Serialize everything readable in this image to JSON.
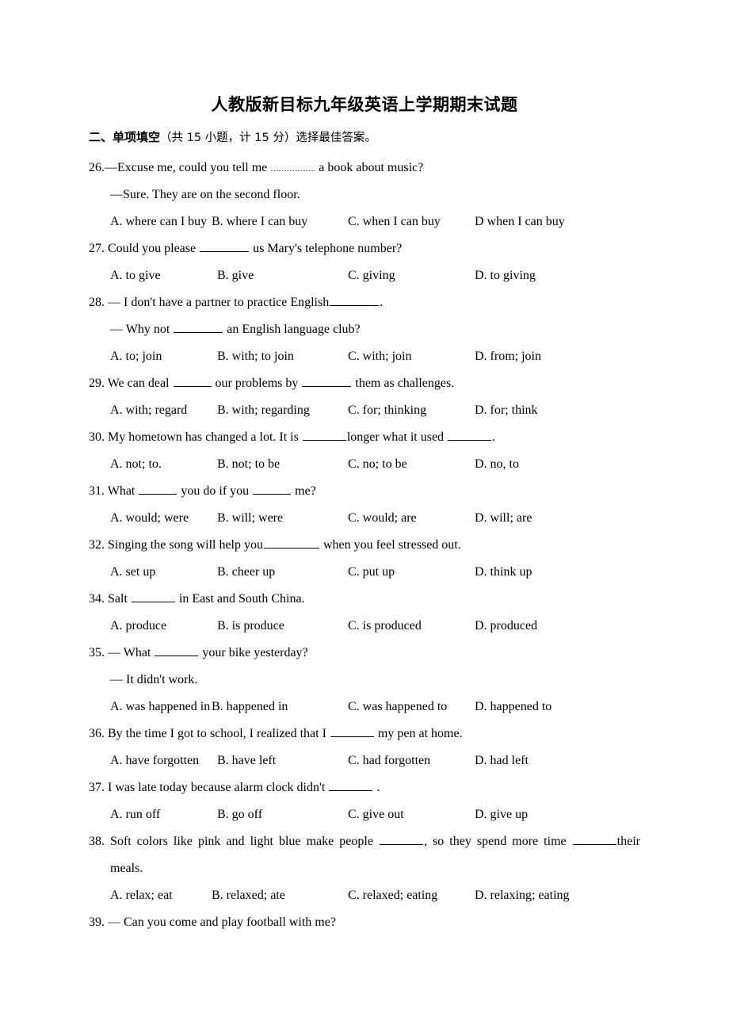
{
  "document": {
    "title": "人教版新目标九年级英语上学期期末试题",
    "section_heading": {
      "bold_part": "二、单项填空",
      "rest": "（共 15 小题，计 15 分）选择最佳答案。"
    }
  },
  "questions": [
    {
      "number": "26.",
      "stem_pre": "—Excuse me, could you tell me",
      "stem_post": "a book about music?",
      "reply": "—Sure. They are on the second floor.",
      "options": [
        "A. where can I buy",
        "B. where I can buy",
        "C. when I can buy",
        "D when I can buy"
      ]
    },
    {
      "number": "27.",
      "stem_pre": "Could you please",
      "stem_post": "us Mary's telephone number?",
      "options": [
        "A. to give",
        "B. give",
        "C. giving",
        "D. to giving"
      ]
    },
    {
      "number": "28.",
      "stem_pre": "— I don't have a partner to practice English",
      "stem_post": ".",
      "reply_pre": "— Why not",
      "reply_post": "an English language club?",
      "options": [
        "A. to; join",
        "B. with; to join",
        "C. with; join",
        "D. from; join"
      ]
    },
    {
      "number": "29.",
      "stem_pre": "We can deal",
      "stem_mid": "our problems by",
      "stem_post": "them as challenges.",
      "options": [
        "A. with; regard",
        "B. with; regarding",
        "C. for; thinking",
        "D. for; think"
      ]
    },
    {
      "number": "30.",
      "stem_pre": "My hometown has changed a lot. It is",
      "stem_mid": "longer what it used",
      "stem_post": ".",
      "options": [
        "A. not; to.",
        "B. not; to be",
        "C. no; to be",
        "D. no, to"
      ]
    },
    {
      "number": "31.",
      "stem_pre": "What",
      "stem_mid": "you do if you",
      "stem_post": "me?",
      "options": [
        "A. would; were",
        "B. will; were",
        "C. would; are",
        "D. will; are"
      ]
    },
    {
      "number": "32.",
      "stem_pre": "Singing the song will help you",
      "stem_post": "when you feel stressed out.",
      "options": [
        "A. set up",
        "B. cheer up",
        "C. put up",
        "D. think up"
      ]
    },
    {
      "number": "34.",
      "stem_pre": "Salt",
      "stem_post": "in East and South China.",
      "options": [
        "A. produce",
        "B. is produce",
        "C. is produced",
        "D. produced"
      ]
    },
    {
      "number": "35.",
      "stem_pre": "— What",
      "stem_post": "your bike yesterday?",
      "reply": "— It didn't work.",
      "options": [
        "A. was happened in",
        "B. happened in",
        "C. was happened to",
        "D. happened to"
      ]
    },
    {
      "number": "36.",
      "stem_pre": "By the time I got to school, I realized that I",
      "stem_post": "my pen at home.",
      "options": [
        "A. have forgotten",
        "B. have left",
        "C. had forgotten",
        "D. had left"
      ]
    },
    {
      "number": "37.",
      "stem_pre": "I was late today because alarm clock didn't",
      "stem_post": ".",
      "options": [
        "A. run off",
        "B. go off",
        "C. give out",
        "D. give up"
      ]
    },
    {
      "number": "38.",
      "stem_pre": "Soft colors like pink and light blue make people",
      "stem_mid": ", so they spend more time",
      "stem_post": "their",
      "stem_wrap": "meals.",
      "options": [
        "A. relax; eat",
        "B. relaxed; ate",
        "C. relaxed; eating",
        "D. relaxing; eating"
      ]
    },
    {
      "number": "39.",
      "stem_pre": "— Can you come and play football with me?",
      "options": []
    }
  ]
}
